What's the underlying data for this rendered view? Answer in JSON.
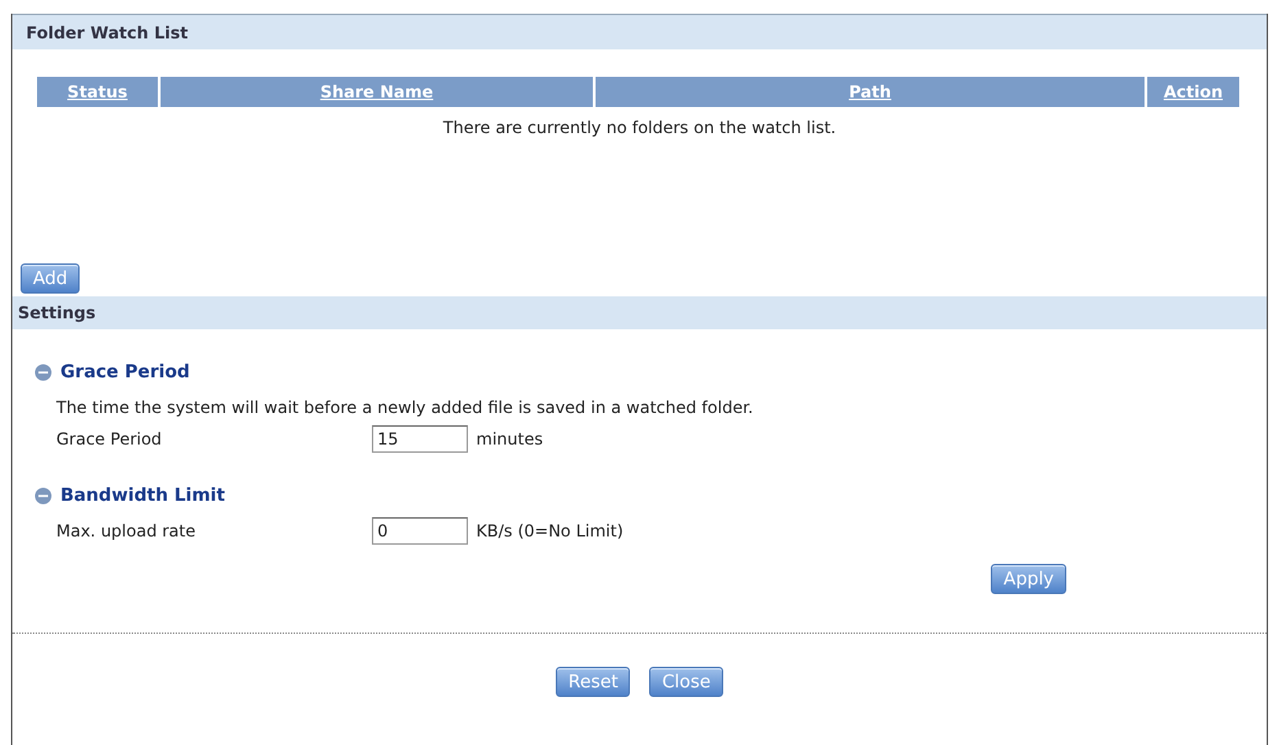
{
  "watch_list": {
    "title": "Folder Watch List",
    "columns": [
      "Status",
      "Share Name",
      "Path",
      "Action"
    ],
    "empty_message": "There are currently no folders on the watch list.",
    "add_button": "Add"
  },
  "settings": {
    "title": "Settings",
    "sections": [
      {
        "title": "Grace Period",
        "expanded": true,
        "description": "The time the system will wait before a newly added file is saved in a watched folder.",
        "field_label": "Grace Period",
        "value": "15",
        "unit": "minutes"
      },
      {
        "title": "Bandwidth Limit",
        "expanded": true,
        "field_label": "Max. upload rate",
        "value": "0",
        "unit": "KB/s (0=No Limit)"
      }
    ],
    "apply_button": "Apply"
  },
  "buttons": [
    "Reset",
    "Close"
  ]
}
